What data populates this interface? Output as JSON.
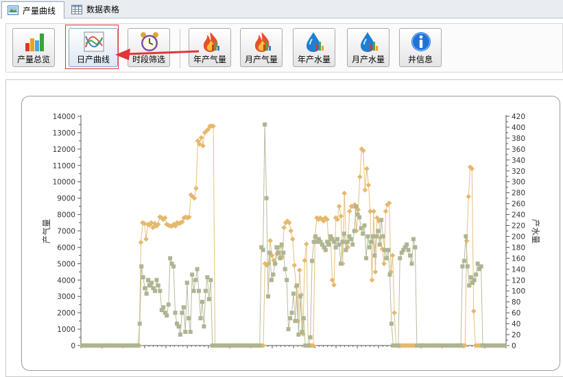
{
  "tabs": [
    {
      "label": "产量曲线",
      "icon": "picture-icon",
      "active": true
    },
    {
      "label": "数据表格",
      "icon": "table-icon",
      "active": false
    }
  ],
  "toolbar": {
    "buttons": [
      {
        "label": "产量总览",
        "icon": "bar-chart-icon"
      },
      {
        "label": "日产曲线",
        "icon": "line-chart-icon",
        "selected": true
      },
      {
        "label": "时段筛选",
        "icon": "alarm-clock-icon"
      },
      {
        "label": "年产气量",
        "icon": "fire-icon"
      },
      {
        "label": "月产气量",
        "icon": "fire-icon"
      },
      {
        "label": "年产水量",
        "icon": "water-drop-icon"
      },
      {
        "label": "月产水量",
        "icon": "water-drop-icon"
      },
      {
        "label": "井信息",
        "icon": "info-icon"
      }
    ]
  },
  "colors": {
    "gas": "#e6b86c",
    "water": "#adb592",
    "highlight": "#e0353a"
  },
  "chart_data": {
    "type": "scatter",
    "left_axis": {
      "label": "产气量",
      "min": 0,
      "max": 14000,
      "ticks": [
        0,
        1000,
        2000,
        3000,
        4000,
        5000,
        6000,
        7000,
        8000,
        9000,
        10000,
        11000,
        12000,
        13000,
        14000
      ]
    },
    "right_axis": {
      "label": "产水量",
      "min": 0,
      "max": 420,
      "ticks": [
        0,
        20,
        40,
        60,
        80,
        100,
        120,
        140,
        160,
        180,
        200,
        220,
        240,
        260,
        280,
        300,
        320,
        340,
        360,
        380,
        400,
        420
      ]
    },
    "series": [
      {
        "axis": "left",
        "marker": "diamond",
        "color": "#e6b86c",
        "values": [
          0,
          0,
          0,
          0,
          0,
          0,
          0,
          0,
          0,
          0,
          0,
          0,
          0,
          0,
          0,
          0,
          0,
          0,
          0,
          0,
          0,
          0,
          0,
          0,
          0,
          0,
          0,
          0,
          0,
          0,
          0,
          0,
          0,
          0,
          6300,
          7500,
          7450,
          6500,
          7400,
          7350,
          7500,
          7200,
          7450,
          7300,
          7400,
          7850,
          7800,
          7700,
          7800,
          7400,
          7350,
          7300,
          7300,
          7400,
          7300,
          7500,
          7450,
          7500,
          7550,
          7800,
          7850,
          7800,
          7850,
          9200,
          9100,
          9000,
          9600,
          12500,
          12300,
          12700,
          12200,
          13000,
          13100,
          13200,
          13400,
          13400,
          13400,
          0,
          0,
          0,
          0,
          0,
          0,
          0,
          0,
          0,
          0,
          0,
          0,
          0,
          0,
          0,
          0,
          0,
          0,
          0,
          0,
          0,
          0,
          0,
          0,
          0,
          0,
          0,
          0,
          0,
          5000,
          4900,
          5000,
          6400,
          5500,
          5200,
          5000,
          5600,
          6000,
          5400,
          5400,
          7200,
          7500,
          7600,
          7500,
          7000,
          6500,
          4900,
          3600,
          1500,
          4600,
          3100,
          700,
          5200,
          6200,
          0,
          0,
          0,
          0,
          6600,
          7800,
          7700,
          7800,
          7700,
          7600,
          7800,
          7700,
          6200,
          6500,
          4000,
          3700,
          7800,
          7700,
          8500,
          7900,
          5000,
          9300,
          6300,
          6000,
          8200,
          8500,
          8500,
          8600,
          7000,
          8300,
          10300,
          12000,
          11900,
          9500,
          10800,
          9800,
          8200,
          4000,
          8200,
          4500,
          7800,
          7600,
          6600,
          5900,
          5000,
          8200,
          8600,
          8700,
          4500,
          5500,
          2000,
          0,
          0,
          0,
          0,
          0,
          0,
          0,
          0,
          0,
          0,
          0,
          0,
          0,
          0,
          0,
          0,
          0,
          0,
          0,
          0,
          0,
          0,
          0,
          0,
          0,
          0,
          0,
          0,
          0,
          0,
          0,
          0,
          0,
          0,
          0,
          0,
          0,
          0,
          0,
          0,
          0,
          6400,
          9100,
          10900,
          10800,
          2100,
          0,
          0,
          0,
          0,
          0,
          0,
          0,
          0,
          0,
          0,
          0,
          0,
          0,
          0,
          0,
          0,
          0,
          0
        ]
      },
      {
        "axis": "right",
        "marker": "square",
        "color": "#adb592",
        "values": [
          0,
          0,
          0,
          0,
          0,
          0,
          0,
          0,
          0,
          0,
          0,
          0,
          0,
          0,
          0,
          0,
          0,
          0,
          0,
          0,
          0,
          0,
          0,
          0,
          0,
          0,
          0,
          0,
          0,
          0,
          0,
          0,
          0,
          0,
          40,
          145,
          125,
          105,
          95,
          120,
          110,
          115,
          105,
          100,
          120,
          110,
          100,
          65,
          70,
          60,
          55,
          75,
          160,
          150,
          145,
          60,
          40,
          35,
          20,
          60,
          70,
          25,
          115,
          50,
          25,
          130,
          100,
          120,
          140,
          100,
          50,
          80,
          35,
          100,
          125,
          85,
          120,
          0,
          0,
          0,
          0,
          0,
          0,
          0,
          0,
          0,
          0,
          0,
          0,
          0,
          0,
          0,
          0,
          0,
          0,
          0,
          0,
          0,
          0,
          0,
          0,
          0,
          0,
          0,
          0,
          0,
          180,
          175,
          405,
          270,
          90,
          170,
          120,
          130,
          150,
          180,
          170,
          160,
          185,
          170,
          140,
          120,
          30,
          50,
          60,
          95,
          45,
          110,
          20,
          90,
          25,
          50,
          0,
          0,
          0,
          15,
          155,
          190,
          200,
          190,
          195,
          190,
          185,
          180,
          175,
          190,
          185,
          200,
          195,
          190,
          180,
          195,
          185,
          150,
          190,
          205,
          175,
          190,
          200,
          195,
          185,
          210,
          255,
          240,
          235,
          215,
          205,
          220,
          160,
          200,
          180,
          190,
          200,
          165,
          200,
          210,
          185,
          230,
          200,
          175,
          160,
          175,
          130,
          40,
          0,
          0,
          0,
          0,
          160,
          170,
          175,
          180,
          185,
          175,
          165,
          150,
          195,
          180,
          0,
          0,
          0,
          0,
          0,
          0,
          0,
          0,
          0,
          0,
          0,
          0,
          0,
          0,
          0,
          0,
          0,
          0,
          0,
          0,
          0,
          0,
          0,
          0,
          0,
          0,
          0,
          145,
          155,
          200,
          145,
          110,
          125,
          115,
          120,
          130,
          150,
          140,
          145,
          0,
          0,
          0,
          0,
          0,
          0,
          0,
          0,
          0,
          0,
          0,
          0,
          0,
          0
        ]
      }
    ]
  }
}
